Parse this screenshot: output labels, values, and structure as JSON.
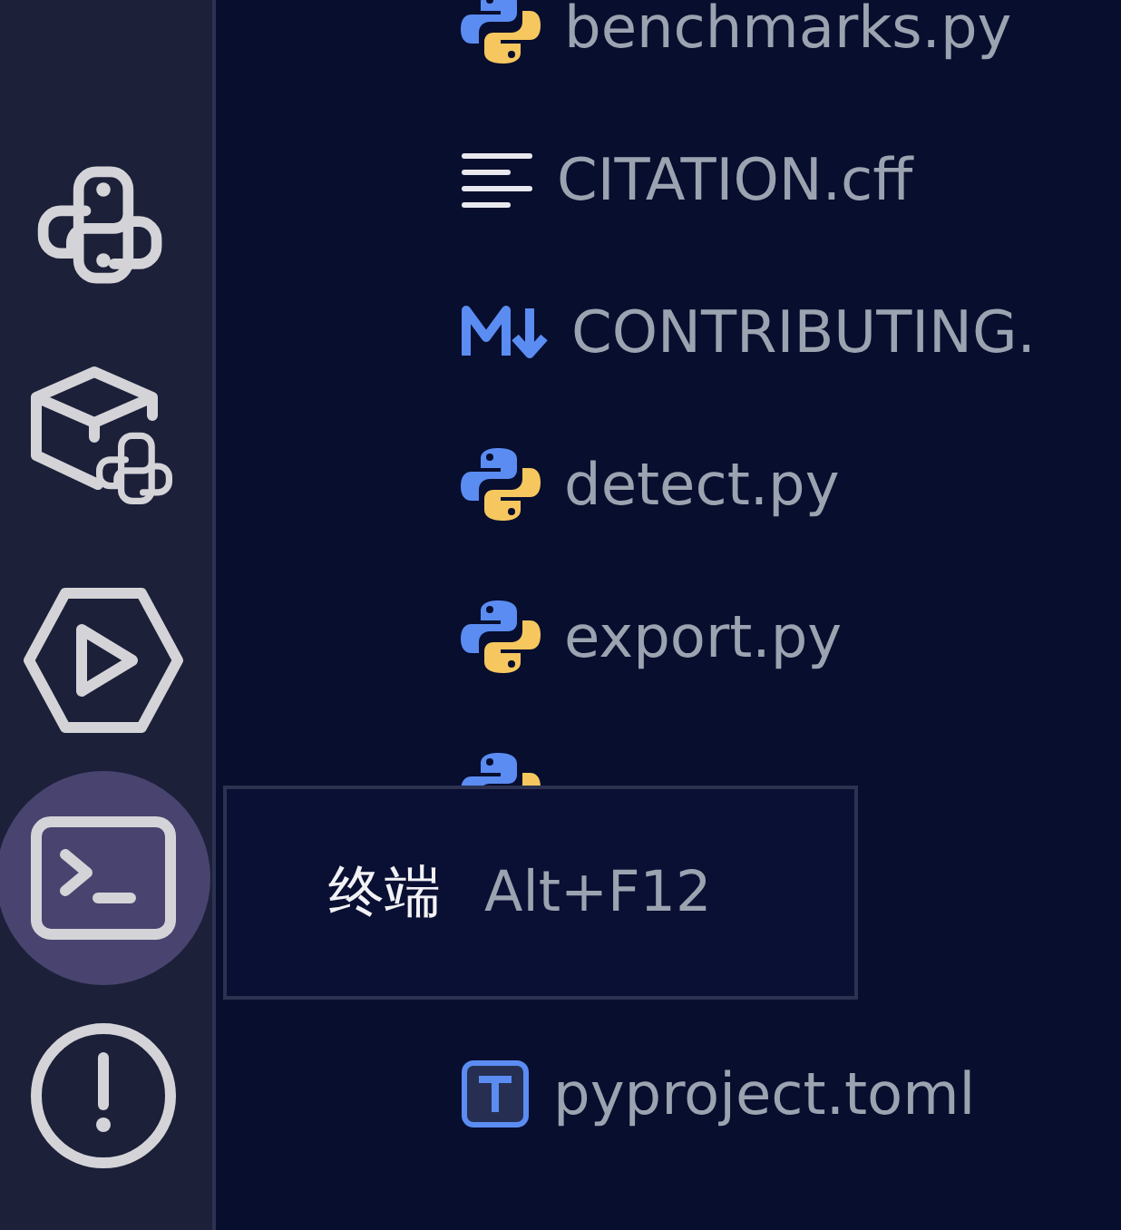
{
  "sidebar": {
    "items": [
      {
        "kind": "python",
        "selected": false
      },
      {
        "kind": "package",
        "selected": false
      },
      {
        "kind": "run",
        "selected": false
      },
      {
        "kind": "terminal",
        "selected": true
      },
      {
        "kind": "problems",
        "selected": false
      }
    ]
  },
  "files": [
    {
      "name": "benchmarks.py",
      "kind": "python"
    },
    {
      "name": "CITATION.cff",
      "kind": "text"
    },
    {
      "name": "CONTRIBUTING.",
      "kind": "markdown"
    },
    {
      "name": "detect.py",
      "kind": "python"
    },
    {
      "name": "export.py",
      "kind": "python"
    },
    {
      "kind": "python"
    },
    {
      "name": "pyproject.toml",
      "kind": "toml"
    }
  ],
  "tooltip": {
    "label": "终端",
    "shortcut": "Alt+F12"
  }
}
